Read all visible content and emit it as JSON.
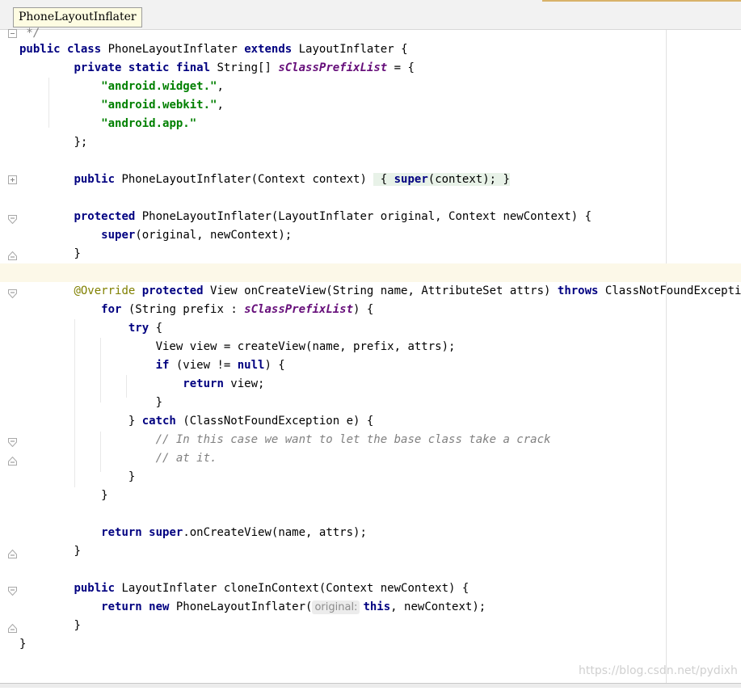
{
  "tooltip": {
    "text": "PhoneLayoutInflater"
  },
  "watermark": {
    "text": "https://blog.csdn.net/pydixh"
  },
  "colors": {
    "keyword": "#000080",
    "string": "#008000",
    "field": "#660e7a",
    "comment": "#808080",
    "annotation": "#808000",
    "caret_line": "#fcf8e8"
  },
  "code": {
    "comment_end": " */",
    "class_decl": {
      "kw_public": "public",
      "kw_class": "class",
      "name": " PhoneLayoutInflater ",
      "kw_extends": "extends",
      "rest": " LayoutInflater {"
    },
    "field_decl": {
      "kw": "private static final",
      "type": " String[] ",
      "name": "sClassPrefixList",
      "rest": " = {"
    },
    "prefix_1": {
      "value": "\"android.widget.\"",
      "tail": ","
    },
    "prefix_2": {
      "value": "\"android.webkit.\"",
      "tail": ","
    },
    "prefix_3": {
      "value": "\"android.app.\""
    },
    "array_close": "};",
    "ctor1": {
      "kw": "public",
      "sig": " PhoneLayoutInflater(Context context) ",
      "open": " { ",
      "kw_super": "super",
      "body": "(context); ",
      "close": "}"
    },
    "ctor2": {
      "kw": "protected",
      "sig": " PhoneLayoutInflater(LayoutInflater original, Context newContext) {"
    },
    "ctor2_super": {
      "kw": "super",
      "rest": "(original, newContext);"
    },
    "ctor2_close": "}",
    "method_decl": {
      "annotation": "@Override",
      "kw_protected": " protected",
      "sig": " View onCreateView(String name, AttributeSet attrs) ",
      "kw_throws": "throws",
      "rest": " ClassNotFoundException {"
    },
    "for_stmt": {
      "kw": "for",
      "mid": " (String prefix : ",
      "field": "sClassPrefixList",
      "rest": ") {"
    },
    "try_stmt": {
      "kw": "try",
      "rest": " {"
    },
    "create_view": "View view = createView(name, prefix, attrs);",
    "if_stmt": {
      "kw": "if",
      "mid": " (view != ",
      "kw_null": "null",
      "rest": ") {"
    },
    "return_view": {
      "kw": "return",
      "rest": " view;"
    },
    "if_close": "}",
    "catch_stmt": {
      "pre": "} ",
      "kw": "catch",
      "rest": " (ClassNotFoundException e) {"
    },
    "comment_1": "// In this case we want to let the base class take a crack",
    "comment_2": "// at it.",
    "catch_close": "}",
    "for_close": "}",
    "return_super": {
      "kw": "return super",
      "rest": ".onCreateView(name, attrs);"
    },
    "method_close": "}",
    "clone_decl": {
      "kw": "public",
      "sig": " LayoutInflater cloneInContext(Context newContext) {"
    },
    "clone_return": {
      "kw": "return new",
      "call": " PhoneLayoutInflater(",
      "hint": "original:",
      "kw_this": "this",
      "rest": ", newContext);"
    },
    "clone_close": "}",
    "class_close": "}"
  }
}
